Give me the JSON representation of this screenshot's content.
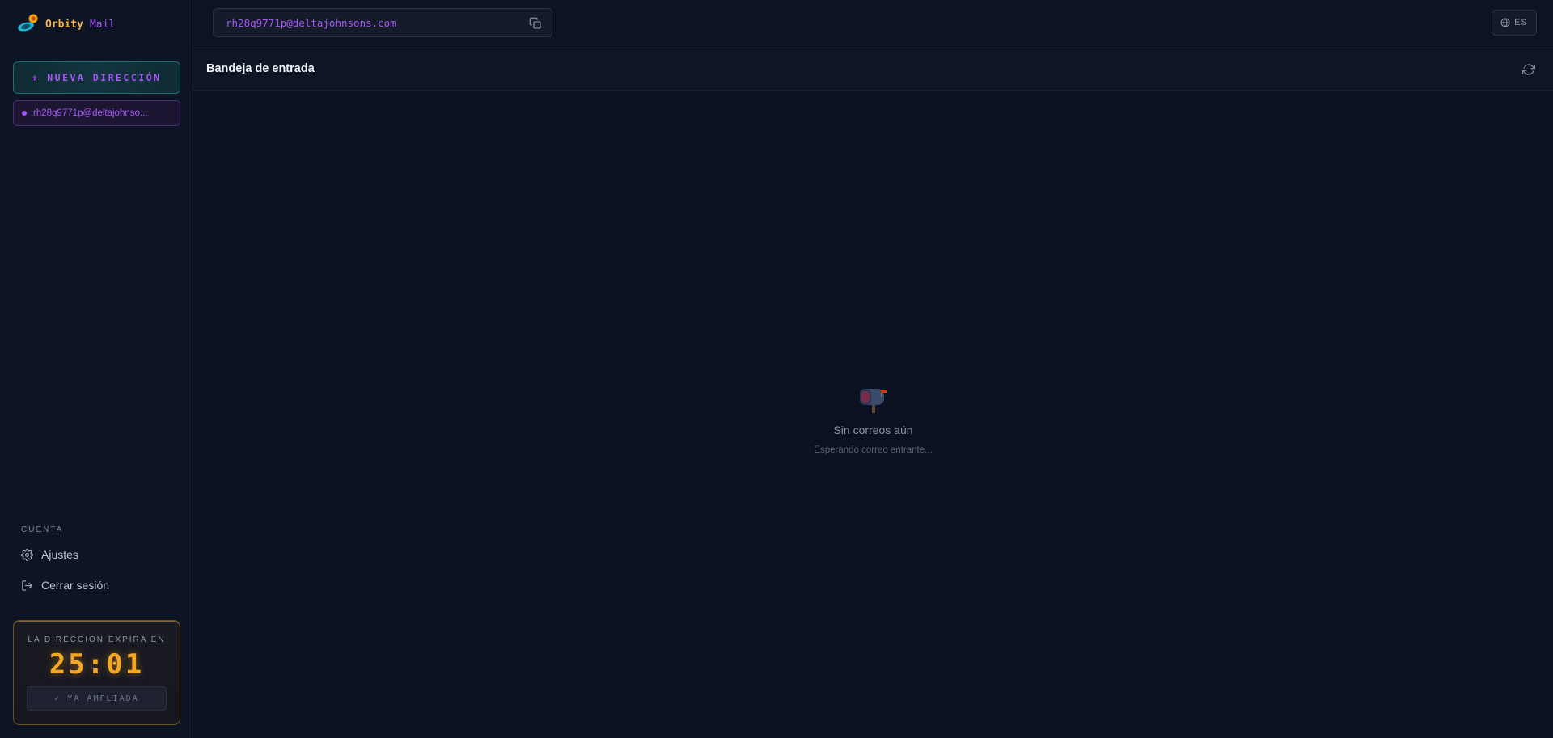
{
  "brand": {
    "name_primary": "Orbity",
    "name_secondary": "Mail"
  },
  "sidebar": {
    "new_address_label": "+ NUEVA DIRECCIÓN",
    "addresses": [
      "rh28q9771p@deltajohnso..."
    ],
    "account_section_label": "CUENTA",
    "settings_label": "Ajustes",
    "logout_label": "Cerrar sesión",
    "expiry": {
      "label": "LA DIRECCIÓN EXPIRA EN",
      "timer": "25:01",
      "extended_label": "✓ YA AMPLIADA"
    }
  },
  "topbar": {
    "current_address": "rh28q9771p@deltajohnsons.com",
    "language": "ES"
  },
  "inbox": {
    "title": "Bandeja de entrada",
    "empty_title": "Sin correos aún",
    "empty_subtitle": "Esperando correo entrante..."
  },
  "colors": {
    "accent_purple": "#a855f7",
    "accent_gold": "#f5a623",
    "background": "#0b1120"
  },
  "icons": {
    "logo": "orbit-planet-icon",
    "copy": "copy-icon",
    "language": "globe-icon",
    "refresh": "refresh-icon",
    "settings": "gear-icon",
    "logout": "logout-icon",
    "empty": "mailbox-icon"
  }
}
